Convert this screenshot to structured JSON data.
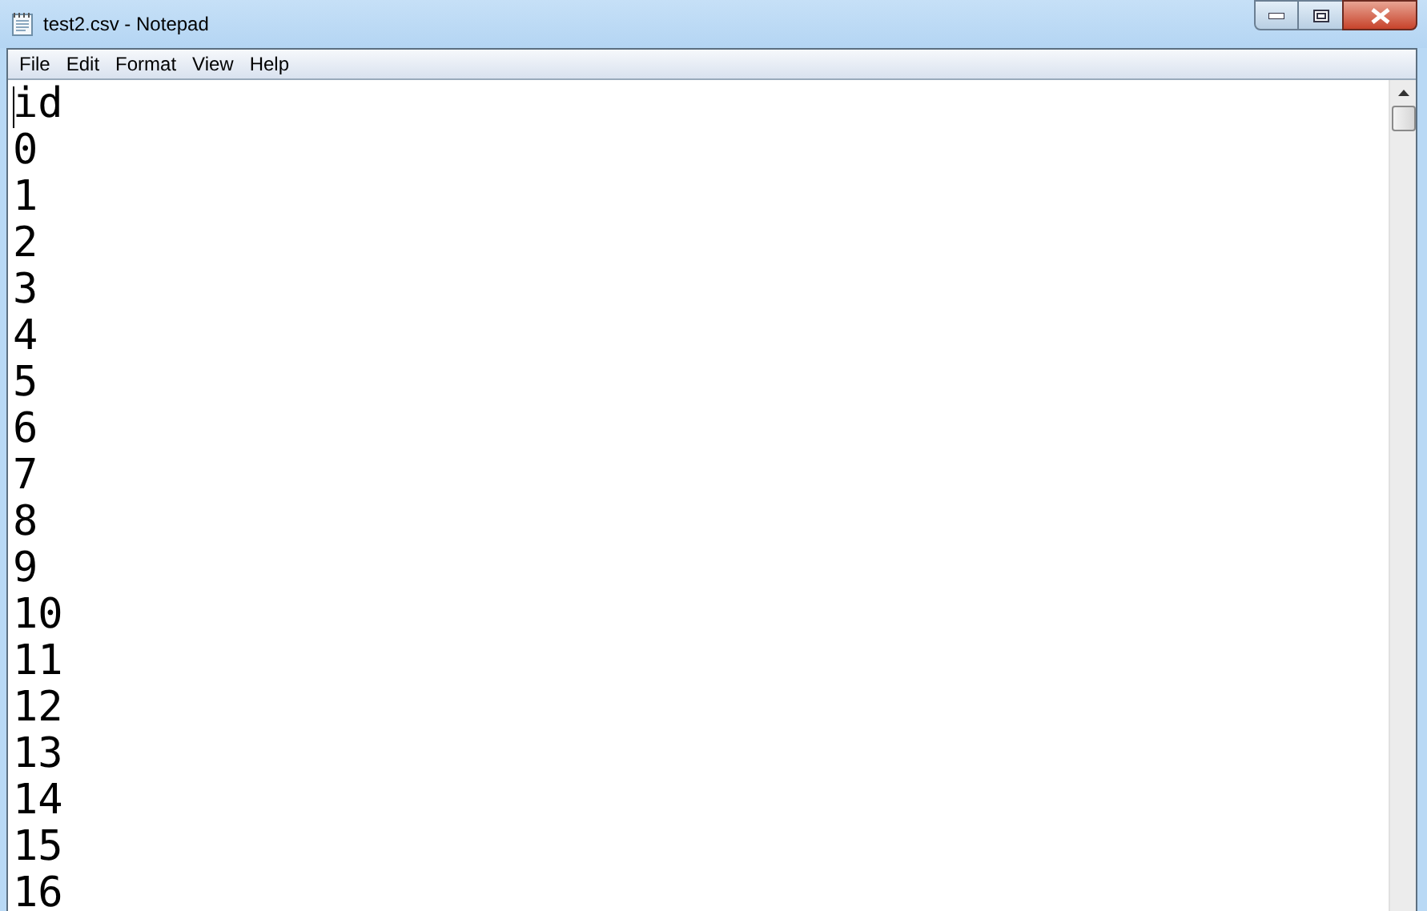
{
  "window": {
    "title": "test2.csv - Notepad"
  },
  "menu": [
    "File",
    "Edit",
    "Format",
    "View",
    "Help"
  ],
  "document": {
    "lines": [
      "id",
      "0",
      "1",
      "2",
      "3",
      "4",
      "5",
      "6",
      "7",
      "8",
      "9",
      "10",
      "11",
      "12",
      "13",
      "14",
      "15",
      "16"
    ]
  }
}
